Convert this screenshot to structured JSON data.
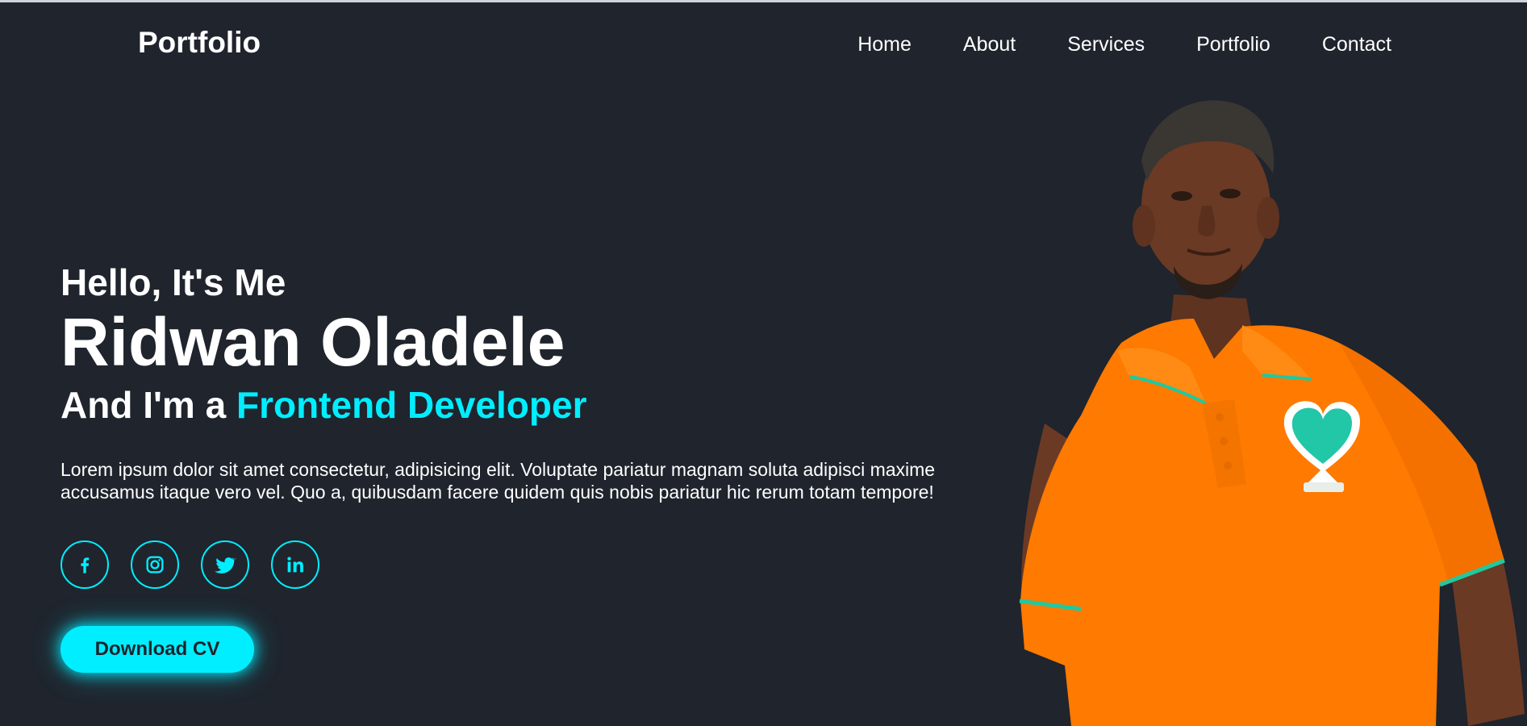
{
  "header": {
    "logo": "Portfolio",
    "nav": [
      "Home",
      "About",
      "Services",
      "Portfolio",
      "Contact"
    ]
  },
  "hero": {
    "greeting": "Hello, It's Me",
    "name": "Ridwan Oladele",
    "role_prefix": "And I'm a",
    "role": "Frontend Developer",
    "description": "Lorem ipsum dolor sit amet consectetur, adipisicing elit. Voluptate pariatur magnam soluta adipisci maxime accusamus itaque vero vel. Quo a, quibusdam facere quidem quis nobis pariatur hic rerum totam tempore!",
    "socials": [
      "facebook-icon",
      "instagram-icon",
      "twitter-icon",
      "linkedin-icon"
    ],
    "cta": "Download CV"
  },
  "colors": {
    "background": "#1f242d",
    "accent": "#00eeff",
    "text": "#ffffff",
    "shirt": "#ff7a00"
  }
}
